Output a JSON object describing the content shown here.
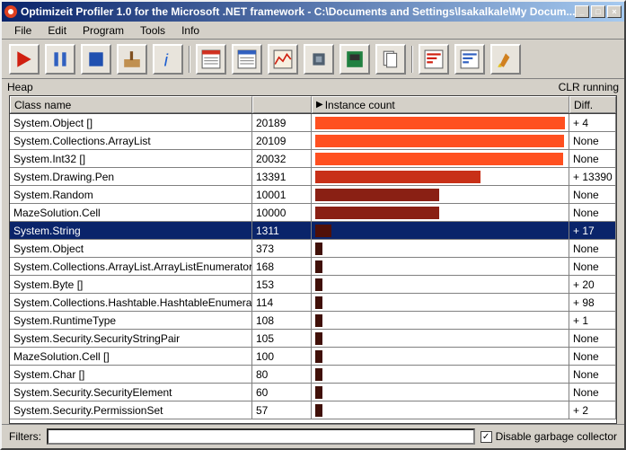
{
  "window": {
    "title": "Optimizeit Profiler 1.0 for the Microsoft .NET framework  -  C:\\Documents and Settings\\lsakalkale\\My Docum..."
  },
  "menubar": [
    "File",
    "Edit",
    "Program",
    "Tools",
    "Info"
  ],
  "heap_label": "Heap",
  "status_right": "CLR running",
  "columns": {
    "class": "Class name",
    "count": "Instance count",
    "diff": "Diff."
  },
  "max_count": 20189,
  "rows": [
    {
      "class": "System.Object []",
      "count": 20189,
      "diff": "+ 4",
      "color": "#ff5020",
      "sel": false
    },
    {
      "class": "System.Collections.ArrayList",
      "count": 20109,
      "diff": "None",
      "color": "#ff5020",
      "sel": false
    },
    {
      "class": "System.Int32 []",
      "count": 20032,
      "diff": "None",
      "color": "#ff5020",
      "sel": false
    },
    {
      "class": "System.Drawing.Pen",
      "count": 13391,
      "diff": "+ 13390",
      "color": "#c83018",
      "sel": false
    },
    {
      "class": "System.Random",
      "count": 10001,
      "diff": "None",
      "color": "#8a2014",
      "sel": false
    },
    {
      "class": "MazeSolution.Cell",
      "count": 10000,
      "diff": "None",
      "color": "#8a2014",
      "sel": false
    },
    {
      "class": "System.String",
      "count": 1311,
      "diff": "+ 17",
      "color": "#501008",
      "sel": true
    },
    {
      "class": "System.Object",
      "count": 373,
      "diff": "None",
      "color": "#401008",
      "sel": false
    },
    {
      "class": "System.Collections.ArrayList.ArrayListEnumerator",
      "count": 168,
      "diff": "None",
      "color": "#401008",
      "sel": false
    },
    {
      "class": "System.Byte []",
      "count": 153,
      "diff": "+ 20",
      "color": "#401008",
      "sel": false
    },
    {
      "class": "System.Collections.Hashtable.HashtableEnumera",
      "count": 114,
      "diff": "+ 98",
      "color": "#401008",
      "sel": false
    },
    {
      "class": "System.RuntimeType",
      "count": 108,
      "diff": "+ 1",
      "color": "#401008",
      "sel": false
    },
    {
      "class": "System.Security.SecurityStringPair",
      "count": 105,
      "diff": "None",
      "color": "#401008",
      "sel": false
    },
    {
      "class": "MazeSolution.Cell []",
      "count": 100,
      "diff": "None",
      "color": "#401008",
      "sel": false
    },
    {
      "class": "System.Char []",
      "count": 80,
      "diff": "None",
      "color": "#401008",
      "sel": false
    },
    {
      "class": "System.Security.SecurityElement",
      "count": 60,
      "diff": "None",
      "color": "#401008",
      "sel": false
    },
    {
      "class": "System.Security.PermissionSet",
      "count": 57,
      "diff": "+ 2",
      "color": "#401008",
      "sel": false
    }
  ],
  "filters_label": "Filters:",
  "gc_label": "Disable garbage collector",
  "gc_checked": true
}
